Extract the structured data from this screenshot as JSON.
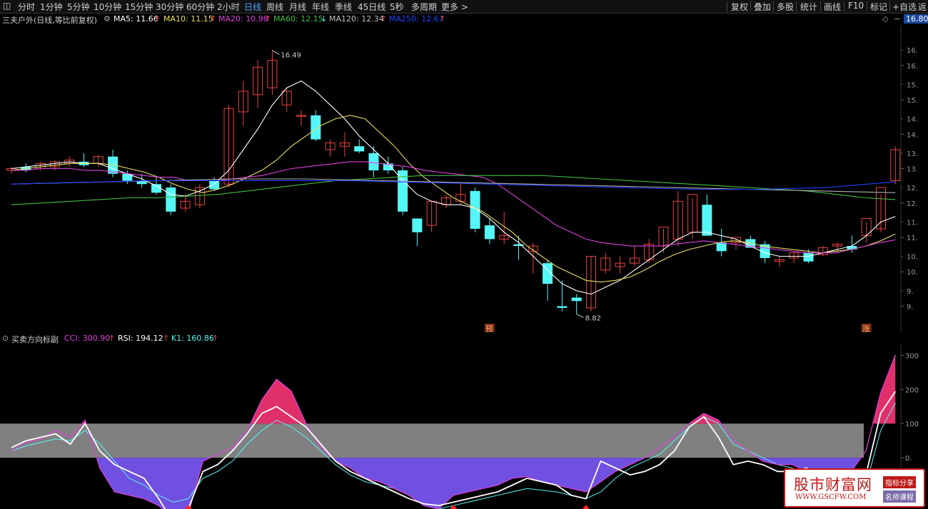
{
  "toolbar": {
    "tabs": [
      "分时",
      "1分钟",
      "5分钟",
      "10分钟",
      "15分钟",
      "30分钟",
      "60分钟",
      "2小时",
      "日线",
      "周线",
      "月线",
      "年线",
      "季线",
      "45日线",
      "5秒",
      "多周期",
      "更多 >"
    ],
    "active_tab": "日线",
    "right_buttons": [
      "复权",
      "叠加",
      "多股",
      "统计",
      "画线",
      "F10",
      "标记",
      "+自选",
      "返"
    ]
  },
  "main_legend": {
    "title": "三夫户外(日线,等比前复权)",
    "ma5": "MA5: 11.66",
    "ma10": "MA10: 11.15",
    "ma20": "MA20: 10.98",
    "ma60": "MA60: 12.15",
    "ma120": "MA120: 12.34",
    "ma250": "MA250: 12.67",
    "price_badge": "16.80"
  },
  "price_axis": {
    "labels": [
      "16.",
      "15.",
      "14.",
      "13.",
      "12.",
      "11.",
      "10.",
      "9.",
      "16.",
      "15.",
      "14.",
      "13.",
      "12.",
      "11.",
      "10.",
      "9."
    ]
  },
  "annotations": {
    "high": "16.49",
    "low": "8.82",
    "mark_yu": "预",
    "mark_zhang": "涨"
  },
  "sub_legend": {
    "title": "买卖方向标副",
    "cci": "CCI: 300.90",
    "rsi": "RSI: 194.12",
    "k1": "K1: 160.86"
  },
  "sub_axis": {
    "labels": [
      "300",
      "200",
      "100",
      "0."
    ]
  },
  "watermark": {
    "title": "股市财富网",
    "url": "WWW.GSCFW.COM",
    "tag1": "指标分享",
    "tag2": "名师课程"
  },
  "colors": {
    "up": "#e8433f",
    "down": "#54f7f7",
    "ma5": "#ffffff",
    "ma10": "#e8e060",
    "ma20": "#e040e0",
    "ma60": "#40c040",
    "ma120": "#b0b0b0",
    "ma250": "#2040ff",
    "band": "#808080",
    "cci_fill_hi": "#e0306a",
    "cci_fill_lo": "#7050e0"
  },
  "chart_data": {
    "type": "candlestick",
    "price_range": [
      8.5,
      17.0
    ],
    "candles": [
      [
        13.0,
        13.1,
        12.9,
        13.05
      ],
      [
        13.1,
        13.2,
        12.95,
        13.0
      ],
      [
        13.05,
        13.25,
        13.0,
        13.2
      ],
      [
        13.1,
        13.3,
        13.0,
        13.25
      ],
      [
        13.2,
        13.4,
        13.1,
        13.3
      ],
      [
        13.25,
        13.5,
        13.1,
        13.15
      ],
      [
        13.2,
        13.45,
        13.1,
        13.4
      ],
      [
        13.4,
        13.6,
        12.8,
        12.9
      ],
      [
        12.9,
        13.0,
        12.6,
        12.7
      ],
      [
        12.7,
        12.9,
        12.5,
        12.6
      ],
      [
        12.6,
        12.8,
        12.3,
        12.35
      ],
      [
        12.5,
        12.6,
        11.7,
        11.8
      ],
      [
        11.9,
        12.3,
        11.8,
        12.1
      ],
      [
        12.0,
        12.6,
        11.9,
        12.5
      ],
      [
        12.7,
        12.8,
        12.4,
        12.45
      ],
      [
        12.6,
        14.9,
        12.5,
        14.8
      ],
      [
        14.7,
        15.6,
        14.3,
        15.3
      ],
      [
        15.2,
        16.2,
        14.8,
        16.0
      ],
      [
        15.4,
        16.49,
        15.2,
        16.2
      ],
      [
        14.9,
        15.4,
        14.7,
        15.3
      ],
      [
        14.6,
        14.75,
        14.3,
        14.6
      ],
      [
        14.6,
        14.75,
        13.85,
        13.9
      ],
      [
        13.6,
        13.9,
        13.4,
        13.8
      ],
      [
        13.7,
        14.1,
        13.4,
        13.8
      ],
      [
        13.7,
        13.9,
        13.5,
        13.55
      ],
      [
        13.5,
        13.7,
        12.8,
        13.0
      ],
      [
        13.2,
        13.4,
        12.9,
        13.0
      ],
      [
        13.0,
        13.1,
        11.7,
        11.8
      ],
      [
        11.6,
        11.6,
        10.8,
        11.2
      ],
      [
        11.4,
        12.1,
        11.2,
        12.1
      ],
      [
        12.0,
        12.3,
        11.9,
        12.2
      ],
      [
        12.1,
        12.6,
        12.0,
        12.3
      ],
      [
        12.4,
        12.5,
        11.2,
        11.3
      ],
      [
        11.4,
        11.6,
        10.85,
        11.0
      ],
      [
        11.0,
        11.8,
        10.85,
        11.1
      ],
      [
        10.85,
        11.1,
        10.4,
        10.8
      ],
      [
        10.65,
        10.9,
        10.0,
        10.8
      ],
      [
        10.3,
        10.4,
        9.2,
        9.7
      ],
      [
        9.05,
        9.8,
        8.9,
        9.0
      ],
      [
        9.3,
        9.4,
        8.82,
        9.2
      ],
      [
        9.0,
        10.5,
        8.9,
        10.5
      ],
      [
        10.1,
        10.6,
        10.0,
        10.45
      ],
      [
        10.2,
        10.5,
        10.0,
        10.3
      ],
      [
        10.3,
        10.8,
        10.2,
        10.45
      ],
      [
        10.4,
        11.0,
        10.3,
        10.85
      ],
      [
        10.8,
        11.3,
        10.6,
        11.35
      ],
      [
        11.0,
        12.4,
        10.8,
        12.1
      ],
      [
        11.2,
        12.2,
        11.0,
        12.3
      ],
      [
        12.0,
        12.3,
        11.2,
        11.1
      ],
      [
        10.9,
        11.3,
        10.5,
        10.65
      ],
      [
        10.9,
        11.0,
        10.7,
        11.05
      ],
      [
        11.0,
        11.1,
        10.8,
        10.75
      ],
      [
        10.85,
        10.95,
        10.3,
        10.45
      ],
      [
        10.35,
        10.5,
        10.2,
        10.4
      ],
      [
        10.45,
        10.6,
        10.3,
        10.6
      ],
      [
        10.6,
        10.7,
        10.3,
        10.35
      ],
      [
        10.55,
        10.8,
        10.5,
        10.75
      ],
      [
        10.8,
        10.9,
        10.6,
        10.85
      ],
      [
        10.8,
        11.1,
        10.6,
        10.7
      ],
      [
        11.1,
        11.5,
        10.9,
        11.6
      ],
      [
        11.3,
        12.3,
        11.2,
        12.5
      ],
      [
        12.7,
        13.7,
        12.6,
        13.6
      ]
    ],
    "ma_series": [
      {
        "name": "MA5",
        "values": [
          13.05,
          13.1,
          13.15,
          13.2,
          13.25,
          13.2,
          13.2,
          13.05,
          12.9,
          12.75,
          12.55,
          12.3,
          12.25,
          12.4,
          12.6,
          13.0,
          13.6,
          14.2,
          14.9,
          15.4,
          15.6,
          15.3,
          14.9,
          14.5,
          14.0,
          13.6,
          13.2,
          12.7,
          12.3,
          12.1,
          12.0,
          12.0,
          11.9,
          11.6,
          11.2,
          10.9,
          10.5,
          10.1,
          9.7,
          9.5,
          9.4,
          9.6,
          9.8,
          10.1,
          10.4,
          10.7,
          11.0,
          11.2,
          11.2,
          11.1,
          11.0,
          10.8,
          10.6,
          10.5,
          10.5,
          10.5,
          10.6,
          10.7,
          10.8,
          11.1,
          11.5,
          11.66
        ]
      },
      {
        "name": "MA10",
        "values": [
          13.0,
          13.05,
          13.1,
          13.15,
          13.2,
          13.2,
          13.2,
          13.15,
          13.05,
          12.95,
          12.8,
          12.6,
          12.45,
          12.35,
          12.45,
          12.6,
          12.8,
          13.0,
          13.3,
          13.7,
          14.0,
          14.3,
          14.5,
          14.6,
          14.5,
          14.1,
          13.7,
          13.2,
          12.8,
          12.5,
          12.2,
          12.0,
          11.8,
          11.5,
          11.2,
          10.8,
          10.5,
          10.2,
          10.0,
          9.8,
          9.75,
          9.8,
          9.9,
          10.1,
          10.35,
          10.55,
          10.7,
          10.8,
          10.9,
          10.95,
          10.9,
          10.8,
          10.75,
          10.7,
          10.65,
          10.6,
          10.65,
          10.7,
          10.8,
          10.95,
          11.15
        ]
      },
      {
        "name": "MA20",
        "values": [
          13.0,
          13.0,
          13.05,
          13.05,
          13.05,
          13.0,
          13.0,
          12.95,
          12.9,
          12.85,
          12.8,
          12.8,
          12.7,
          12.7,
          12.7,
          12.75,
          12.8,
          12.85,
          12.95,
          13.05,
          13.1,
          13.15,
          13.2,
          13.25,
          13.25,
          13.2,
          13.15,
          13.1,
          13.0,
          12.95,
          12.9,
          12.85,
          12.8,
          12.6,
          12.3,
          12.0,
          11.7,
          11.4,
          11.2,
          11.0,
          10.9,
          10.85,
          10.8,
          10.8,
          10.8,
          10.85,
          10.9,
          10.95,
          10.9,
          10.85,
          10.8,
          10.75,
          10.7,
          10.65,
          10.6,
          10.6,
          10.6,
          10.7,
          10.8,
          10.9,
          10.98
        ]
      },
      {
        "name": "MA60",
        "values": [
          12.0,
          12.05,
          12.1,
          12.15,
          12.2,
          12.2,
          12.25,
          12.3,
          12.4,
          12.5,
          12.6,
          12.7,
          12.75,
          12.8,
          12.85,
          12.85,
          12.85,
          12.85,
          12.85,
          12.8,
          12.75,
          12.7,
          12.65,
          12.6,
          12.55,
          12.5,
          12.45,
          12.4,
          12.3,
          12.2,
          12.15
        ]
      },
      {
        "name": "MA120",
        "values": [
          12.6,
          12.65,
          12.7,
          12.75,
          12.75,
          12.7,
          12.65,
          12.6,
          12.55,
          12.5,
          12.45,
          12.4,
          12.35
        ]
      },
      {
        "name": "MA250",
        "values": [
          12.6,
          12.65,
          12.7,
          12.7,
          12.7,
          12.7,
          12.65,
          12.6,
          12.55,
          12.5,
          12.45,
          12.45,
          12.5,
          12.67
        ]
      }
    ],
    "sub_range": [
      -150,
      330
    ],
    "band": [
      0,
      100
    ],
    "cci": [
      20,
      45,
      55,
      80,
      60,
      110,
      -30,
      -100,
      -110,
      -120,
      -140,
      -180,
      -165,
      -10,
      10,
      30,
      80,
      170,
      230,
      195,
      100,
      30,
      -10,
      -30,
      -60,
      -70,
      -90,
      -110,
      -140,
      -150,
      -110,
      -100,
      -90,
      -80,
      -60,
      -55,
      -70,
      -80,
      -90,
      -100,
      -70,
      -40,
      -20,
      0,
      30,
      60,
      100,
      130,
      110,
      50,
      20,
      -10,
      -20,
      -20,
      -40,
      -70,
      -60,
      -40,
      20,
      190,
      300.9
    ],
    "rsi": [
      30,
      50,
      60,
      70,
      40,
      100,
      20,
      -20,
      -40,
      -60,
      -120,
      -190,
      -150,
      -40,
      -20,
      20,
      70,
      130,
      150,
      120,
      90,
      40,
      -10,
      -40,
      -60,
      -80,
      -100,
      -120,
      -135,
      -140,
      -130,
      -120,
      -110,
      -100,
      -80,
      -60,
      -70,
      -80,
      -110,
      -120,
      -10,
      -30,
      -50,
      -40,
      -20,
      20,
      90,
      120,
      60,
      -20,
      -10,
      -20,
      -40,
      -40,
      -30,
      -60,
      -90,
      -70,
      -50,
      130,
      194.12
    ],
    "k1": [
      20,
      35,
      45,
      55,
      50,
      80,
      40,
      -10,
      -60,
      -80,
      -110,
      -130,
      -120,
      -60,
      -40,
      -10,
      40,
      80,
      110,
      90,
      60,
      20,
      -20,
      -50,
      -70,
      -80,
      -90,
      -110,
      -140,
      -150,
      -140,
      -130,
      -120,
      -110,
      -100,
      -90,
      -95,
      -100,
      -110,
      -120,
      -100,
      -60,
      -30,
      -10,
      10,
      50,
      90,
      120,
      100,
      40,
      20,
      0,
      -20,
      -30,
      -50,
      -80,
      -100,
      -90,
      -80,
      80,
      160.86
    ]
  }
}
